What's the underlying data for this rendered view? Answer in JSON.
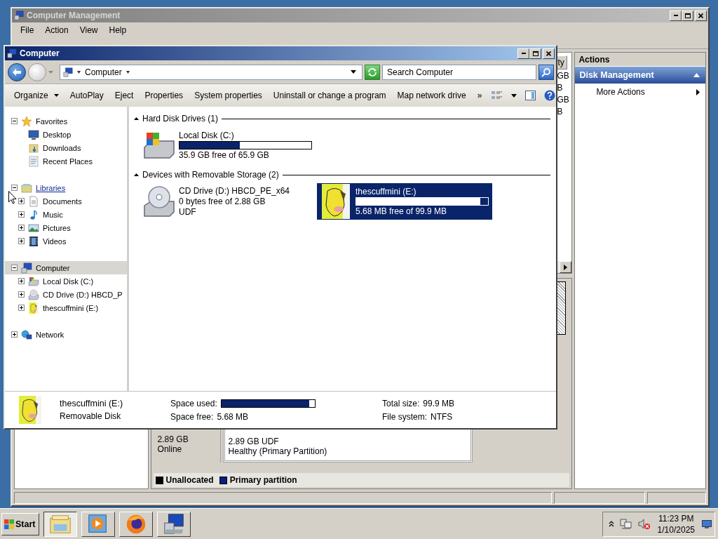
{
  "management": {
    "title": "Computer Management",
    "active": false,
    "menu": [
      "File",
      "Action",
      "View",
      "Help"
    ],
    "list": {
      "header": "ty",
      "cells": [
        "GB",
        "B",
        "GB",
        "B"
      ]
    },
    "disks": [
      {
        "size": "2.89 GB",
        "status": "Online",
        "partition": "2.89 GB UDF",
        "partition_status": "Healthy (Primary Partition)"
      }
    ],
    "legend": [
      {
        "label": "Unallocated",
        "color": "#000000"
      },
      {
        "label": "Primary partition",
        "color": "#0a1e82"
      }
    ],
    "actions": {
      "title": "Actions",
      "section": "Disk Management",
      "items": [
        "More Actions"
      ]
    }
  },
  "explorer": {
    "title": "Computer",
    "active": true,
    "breadcrumb": [
      "Computer"
    ],
    "search": {
      "placeholder": "Search Computer"
    },
    "commands": [
      {
        "label": "Organize",
        "menu": true
      },
      {
        "label": "AutoPlay",
        "menu": false
      },
      {
        "label": "Eject",
        "menu": false
      },
      {
        "label": "Properties",
        "menu": false
      },
      {
        "label": "System properties",
        "menu": false
      },
      {
        "label": "Uninstall or change a program",
        "menu": false
      },
      {
        "label": "Map network drive",
        "menu": false
      }
    ],
    "more_commands": "»",
    "nav": [
      {
        "label": "Favorites",
        "kind": "star",
        "expanded": true,
        "selected": false,
        "children": [
          {
            "label": "Desktop",
            "kind": "desktop",
            "selected": false
          },
          {
            "label": "Downloads",
            "kind": "downloads",
            "selected": false
          },
          {
            "label": "Recent Places",
            "kind": "recent",
            "selected": false
          }
        ]
      },
      {
        "label": "Libraries",
        "kind": "library",
        "link": true,
        "expanded": true,
        "selected": false,
        "children": [
          {
            "label": "Documents",
            "kind": "document",
            "expanded": false,
            "selected": false
          },
          {
            "label": "Music",
            "kind": "music",
            "expanded": false,
            "selected": false
          },
          {
            "label": "Pictures",
            "kind": "pictures",
            "expanded": false,
            "selected": false
          },
          {
            "label": "Videos",
            "kind": "videos",
            "expanded": false,
            "selected": false
          }
        ]
      },
      {
        "label": "Computer",
        "kind": "computer",
        "expanded": true,
        "selected": true,
        "children": [
          {
            "label": "Local Disk (C:)",
            "kind": "hdd",
            "expanded": false,
            "selected": false
          },
          {
            "label": "CD Drive (D:) HBCD_P",
            "kind": "cd",
            "expanded": false,
            "selected": false
          },
          {
            "label": "thescuffmini (E:)",
            "kind": "picture",
            "expanded": false,
            "selected": false
          }
        ]
      },
      {
        "label": "Network",
        "kind": "network",
        "expanded": false,
        "selected": false
      }
    ],
    "groups": [
      {
        "title": "Hard Disk Drives (1)",
        "expanded": true,
        "drives": [
          {
            "name": "Local Disk (C:)",
            "kind": "hdd",
            "level": 0.455,
            "info": [
              "35.9 GB free of 65.9 GB"
            ],
            "selected": false
          }
        ]
      },
      {
        "title": "Devices with Removable Storage (2)",
        "expanded": true,
        "drives": [
          {
            "name": "CD Drive (D:) HBCD_PE_x64",
            "kind": "cd",
            "info": [
              "0 bytes free of 2.88 GB",
              "UDF"
            ],
            "selected": false
          },
          {
            "name": "thescuffmini (E:)",
            "kind": "picture",
            "level": 0.943,
            "info": [
              "5.68 MB free of 99.9 MB"
            ],
            "selected": true
          }
        ]
      }
    ],
    "details": {
      "name": "thescuffmini (E:)",
      "type": "Removable Disk",
      "usage": {
        "label": "Space used:",
        "level": 0.943
      },
      "free_label": "Space free:",
      "free_value": "5.68 MB",
      "total_label": "Total size:",
      "total_value": "99.9 MB",
      "fs_label": "File system:",
      "fs_value": "NTFS"
    }
  },
  "taskbar": {
    "start": "Start",
    "apps": [
      {
        "kind": "folder",
        "selected": true
      },
      {
        "kind": "media",
        "selected": false
      },
      {
        "kind": "browser",
        "selected": false
      },
      {
        "kind": "computer",
        "selected": false
      }
    ],
    "time": "11:23 PM",
    "date": "1/10/2025"
  }
}
